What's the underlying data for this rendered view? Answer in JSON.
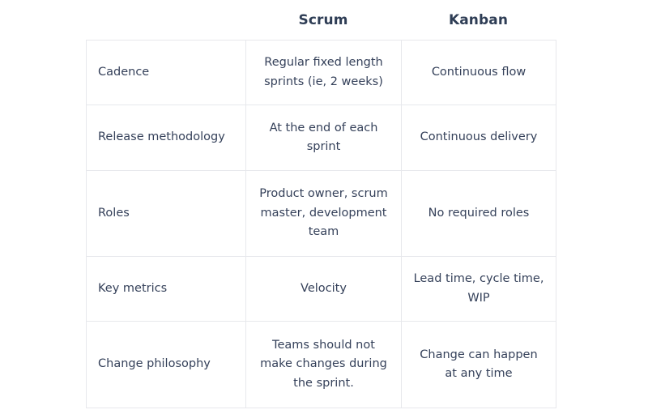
{
  "table": {
    "headers": {
      "col0": "",
      "col1": "Scrum",
      "col2": "Kanban"
    },
    "rows": [
      {
        "label": "Cadence",
        "scrum": "Regular fixed length sprints (ie, 2 weeks)",
        "kanban": "Continuous flow"
      },
      {
        "label": "Release methodology",
        "scrum": "At the end of each sprint",
        "kanban": "Continuous delivery"
      },
      {
        "label": "Roles",
        "scrum": "Product owner, scrum master, development team",
        "kanban": "No required roles"
      },
      {
        "label": "Key metrics",
        "scrum": "Velocity",
        "kanban": "Lead time, cycle time, WIP"
      },
      {
        "label": "Change philosophy",
        "scrum": "Teams should not make changes during the sprint.",
        "kanban": "Change can happen at any time"
      }
    ]
  },
  "colors": {
    "page_background": "#ffffff",
    "header_text": "#2e3d55",
    "body_text": "#35415a",
    "border": "#e7e8ec"
  }
}
